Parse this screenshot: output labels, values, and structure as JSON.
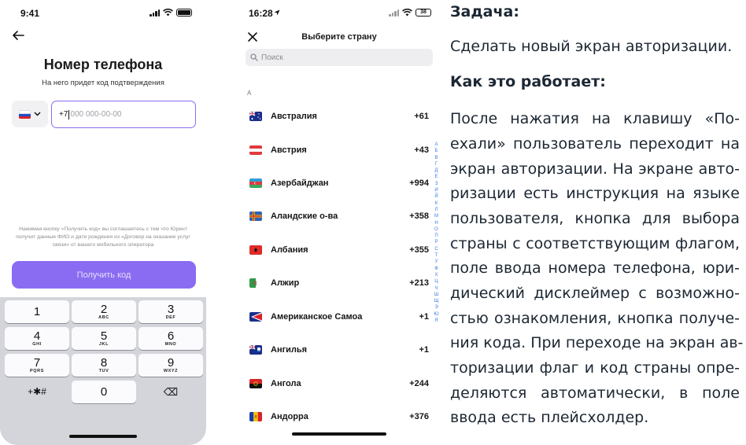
{
  "screen1": {
    "status_time": "9:41",
    "title": "Номер телефона",
    "subtitle": "На него придет код подтверждения",
    "phone_code": "+7",
    "phone_placeholder": "000 000-00-00",
    "disclaimer": "Нажимая кнопку «Получить код» вы соглашаетесь с тем что Юрент получит данные ФИО и дате рождения из «Договор на оказание услуг связи» от вашего мобильного оператора",
    "get_code_label": "Получить код",
    "keys": [
      {
        "digit": "1",
        "letters": ""
      },
      {
        "digit": "2",
        "letters": "ABC"
      },
      {
        "digit": "3",
        "letters": "DEF"
      },
      {
        "digit": "4",
        "letters": "GHI"
      },
      {
        "digit": "5",
        "letters": "JKL"
      },
      {
        "digit": "6",
        "letters": "MNO"
      },
      {
        "digit": "7",
        "letters": "PQRS"
      },
      {
        "digit": "8",
        "letters": "TUV"
      },
      {
        "digit": "9",
        "letters": "WXYZ"
      },
      {
        "digit": "+✱#",
        "letters": ""
      },
      {
        "digit": "0",
        "letters": ""
      },
      {
        "digit": "⌫",
        "letters": ""
      }
    ],
    "icons": {
      "back": "arrow-left-icon",
      "flag": "russia-flag-icon",
      "dropdown": "chevron-down-icon",
      "delete": "backspace-icon"
    },
    "accent_color": "#8a6cf2"
  },
  "screen2": {
    "status_time": "16:28",
    "battery_level": "38",
    "title": "Выберите страну",
    "search_placeholder": "Поиск",
    "section_letter": "А",
    "countries": [
      {
        "name": "Австралия",
        "code": "+61"
      },
      {
        "name": "Австрия",
        "code": "+43"
      },
      {
        "name": "Азербайджан",
        "code": "+994"
      },
      {
        "name": "Аландские о-ва",
        "code": "+358"
      },
      {
        "name": "Албания",
        "code": "+355"
      },
      {
        "name": "Алжир",
        "code": "+213"
      },
      {
        "name": "Американское Самоа",
        "code": "+1"
      },
      {
        "name": "Ангилья",
        "code": "+1"
      },
      {
        "name": "Ангола",
        "code": "+244"
      },
      {
        "name": "Андорра",
        "code": "+376"
      }
    ],
    "alphabet": [
      "А",
      "Б",
      "В",
      "Г",
      "Д",
      "Е",
      "З",
      "И",
      "Й",
      "К",
      "Л",
      "М",
      "Н",
      "О",
      "П",
      "Р",
      "С",
      "Т",
      "У",
      "Ф",
      "Х",
      "Ц",
      "Ч",
      "Ш",
      "Щ",
      "Э",
      "Ю",
      "Я"
    ],
    "icons": {
      "close": "close-icon",
      "search": "search-icon"
    },
    "index_color": "#3d7be6"
  },
  "description": {
    "task_heading": "Задача:",
    "task_text": "Сделать новый экран авторизации.",
    "how_heading": "Как это работает:",
    "lines": [
      "После нажатия на клавишу «По-",
      "ехали» пользователь переходит на",
      "экран авторизации. На экране авто-",
      "ризации есть инструкция на языке",
      "пользователя, кнопка для выбора",
      "страны с соответствующим флагом,",
      "поле ввода номера телефона, юри-",
      "дический дисклеймер с возможно-",
      "стью ознакомления, кнопка получе-",
      "ния кода. При переходе на экран ав-",
      "торизации флаг и код страны опре-",
      "деляются автоматически, в поле",
      "ввода есть плейсхолдер."
    ]
  }
}
